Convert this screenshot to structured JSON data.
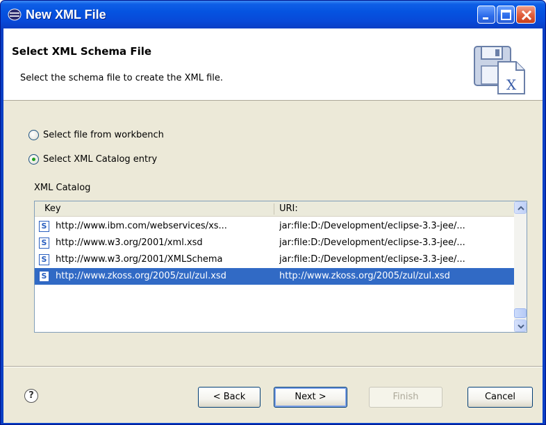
{
  "window": {
    "title": "New XML File"
  },
  "header": {
    "title": "Select XML Schema File",
    "description": "Select the schema file to create the XML file."
  },
  "options": {
    "workbench_label": "Select file from workbench",
    "catalog_label": "Select XML Catalog entry",
    "selected": "catalog"
  },
  "catalog": {
    "label": "XML Catalog",
    "columns": {
      "key": "Key",
      "uri": "URI:"
    },
    "rows": [
      {
        "key": "http://www.ibm.com/webservices/xs...",
        "uri": "jar:file:D:/Development/eclipse-3.3-jee/..."
      },
      {
        "key": "http://www.w3.org/2001/xml.xsd",
        "uri": "jar:file:D:/Development/eclipse-3.3-jee/..."
      },
      {
        "key": "http://www.w3.org/2001/XMLSchema",
        "uri": "jar:file:D:/Development/eclipse-3.3-jee/..."
      },
      {
        "key": "http://www.zkoss.org/2005/zul/zul.xsd",
        "uri": "http://www.zkoss.org/2005/zul/zul.xsd"
      }
    ],
    "row_icon": "S",
    "selected_row": 3
  },
  "buttons": {
    "back": "< Back",
    "next": "Next >",
    "finish": "Finish",
    "cancel": "Cancel"
  },
  "help": "?",
  "colors": {
    "titlebar": "#0553e0",
    "selection": "#316ac5",
    "face": "#ece9d8"
  }
}
